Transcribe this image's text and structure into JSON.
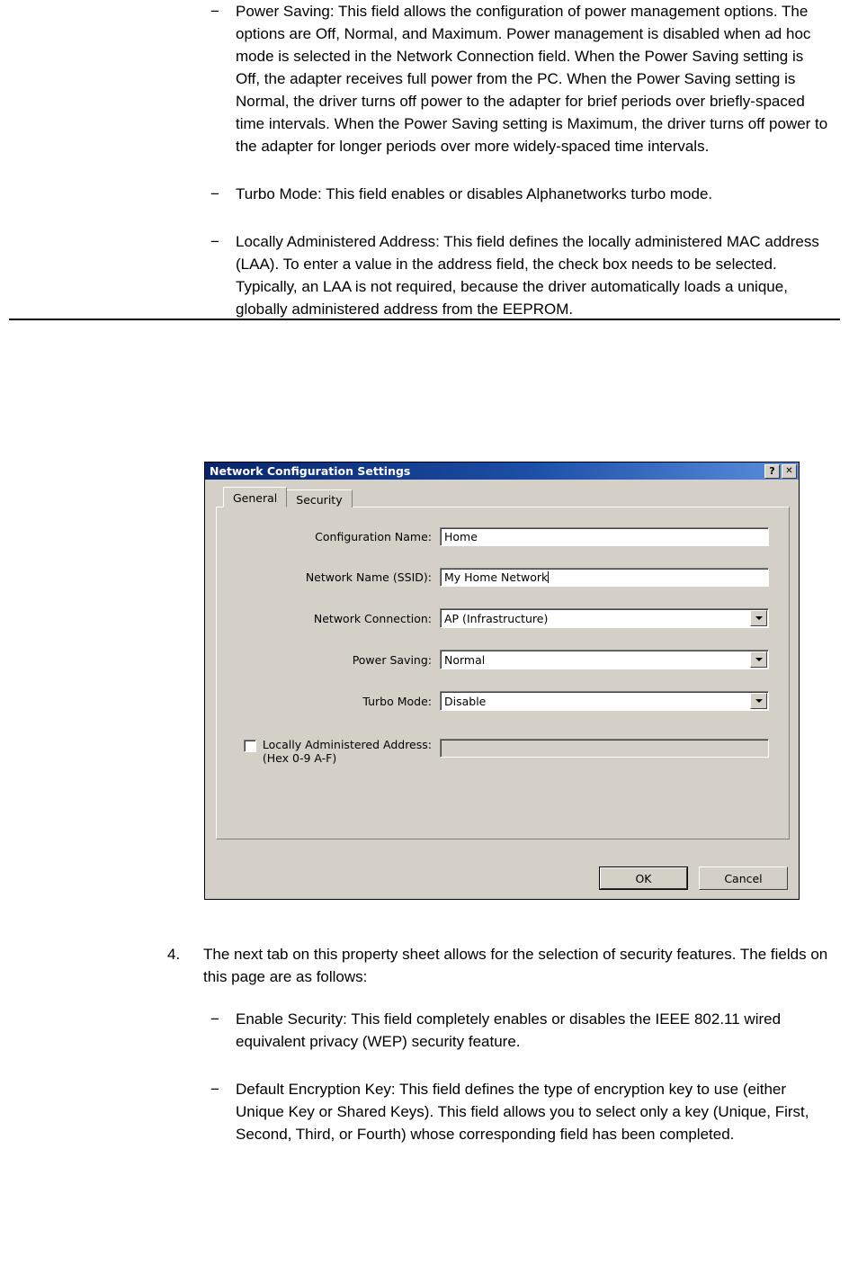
{
  "document": {
    "bullets_top": [
      {
        "mark": "−",
        "text": "Power Saving: This field allows the configuration of power management options. The options are Off, Normal, and Maximum. Power management is disabled when ad hoc mode is selected in the Network Connection field. When the Power Saving setting is Off, the adapter receives full power from the PC. When the Power Saving setting is Normal, the driver turns off power to the adapter for brief periods over briefly-spaced time intervals. When the Power Saving setting is Maximum, the driver turns off power to the adapter for longer periods over more widely-spaced time intervals."
      },
      {
        "mark": "−",
        "text": "Turbo Mode: This field enables or disables Alphanetworks turbo mode."
      },
      {
        "mark": "−",
        "text": "Locally Administered Address: This field defines the locally administered MAC address (LAA). To enter a value in the address field, the check box needs to be selected. Typically, an LAA is not required, because the driver automatically loads a unique, globally administered address from the EEPROM."
      }
    ],
    "step4": {
      "number": "4.",
      "text": "The next tab on this property sheet allows for the selection of security features. The fields on this page are as follows:"
    },
    "bullets_bottom": [
      {
        "mark": "−",
        "text": "Enable Security: This field completely enables or disables the IEEE 802.11 wired equivalent privacy (WEP) security feature."
      },
      {
        "mark": "−",
        "text": "Default Encryption Key: This field defines the type of encryption key to use (either Unique Key or Shared Keys). This field allows you to select only a key (Unique, First, Second, Third, or Fourth) whose corresponding field has been completed."
      }
    ]
  },
  "dialog": {
    "title": "Network Configuration Settings",
    "help_button": "?",
    "close_button": "✕",
    "tabs": [
      {
        "label": "General",
        "active": true
      },
      {
        "label": "Security",
        "active": false
      }
    ],
    "fields": {
      "config_name": {
        "label": "Configuration Name:",
        "value": "Home"
      },
      "ssid": {
        "label": "Network Name (SSID):",
        "value": "My Home Network"
      },
      "network_connection": {
        "label": "Network Connection:",
        "value": "AP (Infrastructure)"
      },
      "power_saving": {
        "label": "Power Saving:",
        "value": "Normal"
      },
      "turbo_mode": {
        "label": "Turbo Mode:",
        "value": "Disable"
      },
      "laa": {
        "label_line1": "Locally Administered Address:",
        "label_line2": "(Hex 0-9 A-F)",
        "value": "",
        "checked": false
      }
    },
    "buttons": {
      "ok": "OK",
      "cancel": "Cancel"
    }
  },
  "colors": {
    "titlebar_start": "#08246b",
    "titlebar_end": "#5c8ede",
    "dialog_face": "#d4d0c8",
    "field_white": "#ffffff"
  }
}
